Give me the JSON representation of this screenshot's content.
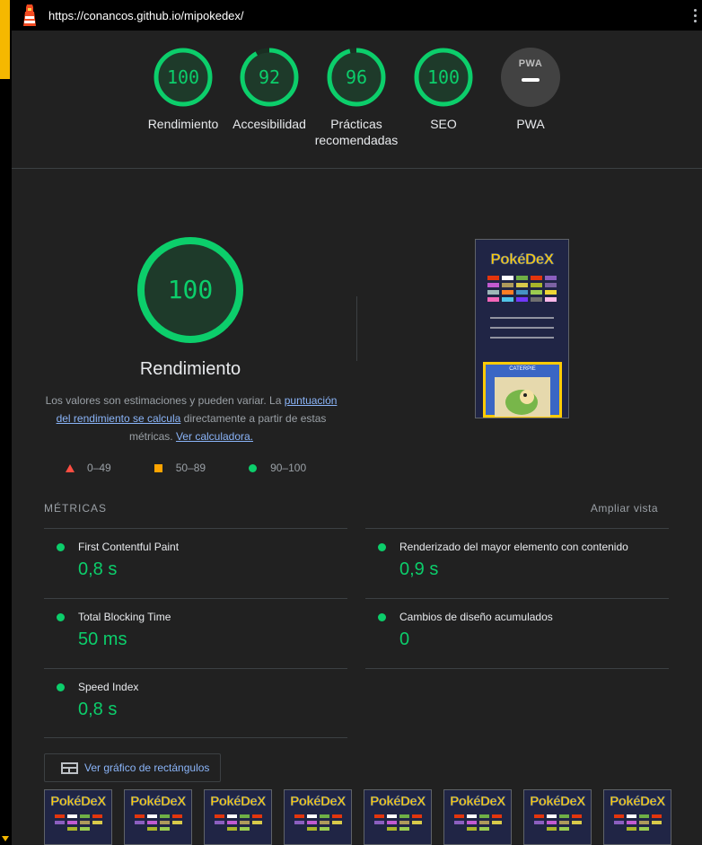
{
  "topbar": {
    "url": "https://conancos.github.io/mipokedex/"
  },
  "summary": {
    "gauges": [
      {
        "score": "100",
        "label": "Rendimiento"
      },
      {
        "score": "92",
        "label": "Accesibilidad"
      },
      {
        "score": "96",
        "label": "Prácticas recomendadas"
      },
      {
        "score": "100",
        "label": "SEO"
      }
    ],
    "pwa": {
      "badge": "PWA",
      "label": "PWA"
    }
  },
  "performance": {
    "score": "100",
    "title": "Rendimiento",
    "desc_prefix": "Los valores son estimaciones y pueden variar. La ",
    "desc_link": "puntuación del rendimiento se calcula",
    "desc_middle": " directamente a partir de estas métricas. ",
    "desc_link2": "Ver calculadora."
  },
  "legend": {
    "fail": "0–49",
    "average": "50–89",
    "pass": "90–100"
  },
  "metrics": {
    "title": "MÉTRICAS",
    "expand": "Ampliar vista",
    "items": [
      {
        "name": "First Contentful Paint",
        "value": "0,8 s"
      },
      {
        "name": "Renderizado del mayor elemento con contenido",
        "value": "0,9 s"
      },
      {
        "name": "Total Blocking Time",
        "value": "50 ms"
      },
      {
        "name": "Cambios de diseño acumulados",
        "value": "0"
      },
      {
        "name": "Speed Index",
        "value": "0,8 s"
      }
    ]
  },
  "treemap_button": "Ver gráfico de rectángulos",
  "screenshot": {
    "logo": "PokéDeX",
    "card_title": "CATERPIE"
  },
  "colors": {
    "pass": "#0cce6b",
    "average": "#ffa400",
    "fail": "#ff4e42",
    "link": "#8ab4f8"
  }
}
